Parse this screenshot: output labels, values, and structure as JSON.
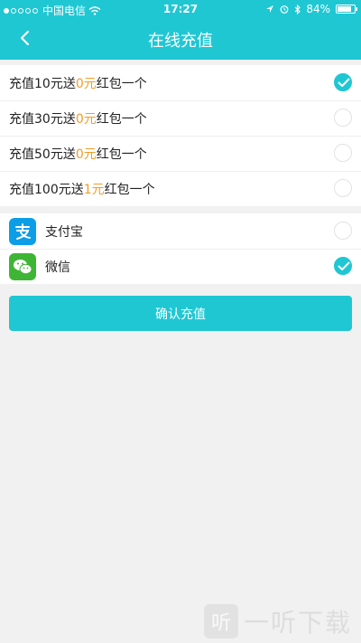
{
  "status": {
    "carrier": "中国电信",
    "time": "17:27",
    "battery": "84%",
    "battery_level": 0.84
  },
  "nav": {
    "title": "在线充值",
    "back_icon": "chevron-left-icon"
  },
  "recharge_options": [
    {
      "pre": "充值10元送",
      "bonus": "0元",
      "post": "红包一个",
      "selected": true
    },
    {
      "pre": "充值30元送",
      "bonus": "0元",
      "post": "红包一个",
      "selected": false
    },
    {
      "pre": "充值50元送",
      "bonus": "0元",
      "post": "红包一个",
      "selected": false
    },
    {
      "pre": "充值100元送",
      "bonus": "1元",
      "post": "红包一个",
      "selected": false
    }
  ],
  "payment_methods": [
    {
      "label": "支付宝",
      "icon": "alipay-icon",
      "selected": false
    },
    {
      "label": "微信",
      "icon": "wechat-icon",
      "selected": true
    }
  ],
  "confirm_label": "确认充值",
  "watermark": {
    "icon_text": "听",
    "text": "一听下载"
  },
  "colors": {
    "accent": "#1fc7d3",
    "highlight": "#f39c24",
    "alipay": "#0b9ee7",
    "wechat": "#3fb536"
  }
}
